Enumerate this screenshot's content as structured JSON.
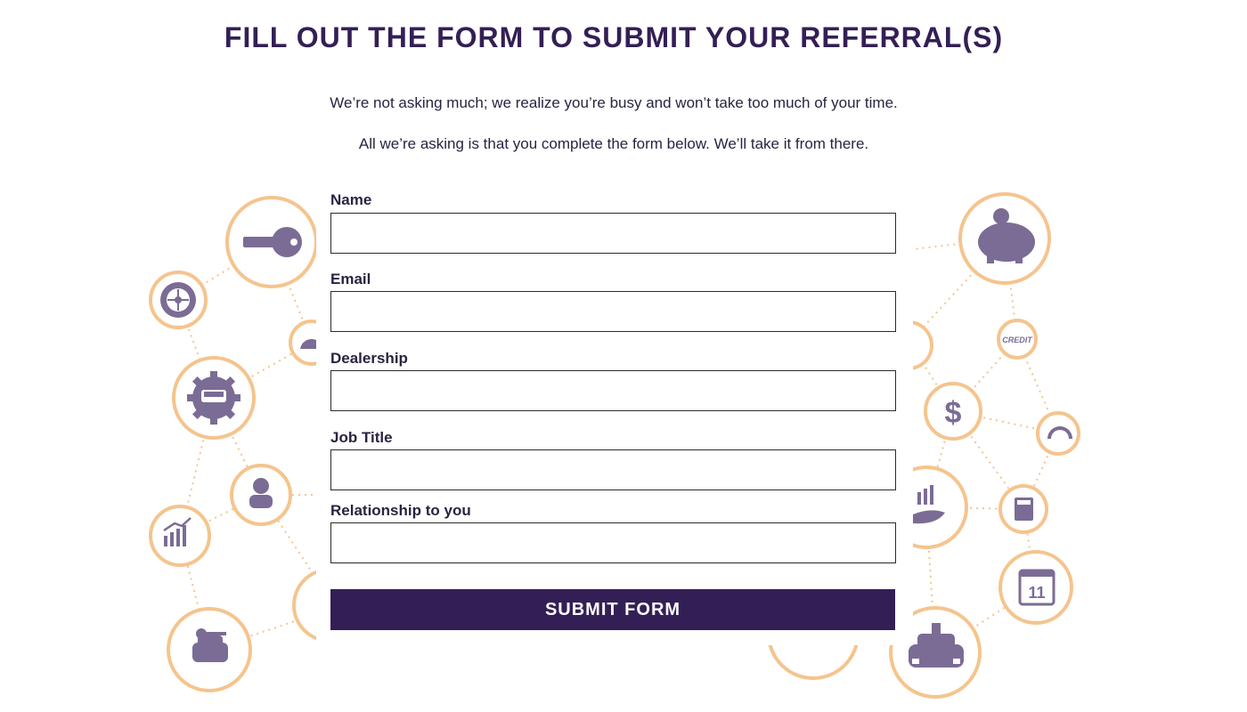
{
  "header": {
    "title": "FILL OUT THE FORM TO SUBMIT YOUR REFERRAL(S)",
    "intro_line_1": "We’re not asking much; we realize you’re busy and won’t take too much of your time.",
    "intro_line_2": "All we’re asking is that you complete the form below. We’ll take it from there."
  },
  "form": {
    "fields": [
      {
        "label": "Name",
        "value": ""
      },
      {
        "label": "Email",
        "value": ""
      },
      {
        "label": "Dealership",
        "value": ""
      },
      {
        "label": "Job Title",
        "value": ""
      },
      {
        "label": "Relationship to you",
        "value": ""
      }
    ],
    "submit_label": "SUBMIT FORM"
  },
  "decorations": {
    "credit_text": "CREDIT",
    "calendar_day": "11",
    "colors": {
      "ring": "#f5c48e",
      "icon": "#7b6c95",
      "brand": "#331f55"
    }
  }
}
